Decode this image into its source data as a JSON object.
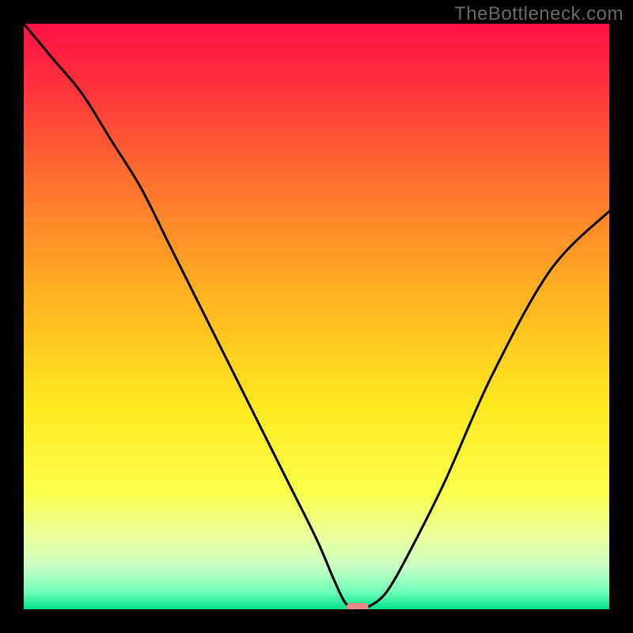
{
  "watermark": "TheBottleneck.com",
  "chart_data": {
    "type": "line",
    "title": "",
    "xlabel": "",
    "ylabel": "",
    "xlim": [
      0,
      100
    ],
    "ylim": [
      0,
      100
    ],
    "legend": false,
    "grid": false,
    "axes_visible": false,
    "background_gradient": {
      "stops": [
        {
          "pos": 0.0,
          "color": "#ff1245"
        },
        {
          "pos": 0.1,
          "color": "#ff2f3d"
        },
        {
          "pos": 0.25,
          "color": "#ff6a2f"
        },
        {
          "pos": 0.45,
          "color": "#ffae22"
        },
        {
          "pos": 0.65,
          "color": "#ffe81e"
        },
        {
          "pos": 0.8,
          "color": "#faff4a"
        },
        {
          "pos": 0.88,
          "color": "#eaffa0"
        },
        {
          "pos": 0.93,
          "color": "#c4ffc4"
        },
        {
          "pos": 0.97,
          "color": "#6fffb8"
        },
        {
          "pos": 1.0,
          "color": "#00e28a"
        }
      ]
    },
    "marker": {
      "x": 57,
      "y": 0,
      "color": "#e98a86",
      "shape": "pill"
    },
    "series": [
      {
        "name": "bottleneck-curve",
        "color": "#000000",
        "x": [
          0,
          5,
          10,
          15,
          20,
          25,
          30,
          35,
          40,
          45,
          50,
          53,
          55,
          57,
          59,
          62,
          66,
          72,
          80,
          90,
          100
        ],
        "y": [
          100,
          94,
          88,
          80,
          72,
          62,
          52,
          42,
          32,
          22,
          12,
          5,
          1,
          0,
          0.5,
          3,
          10,
          22,
          40,
          58,
          68
        ]
      }
    ]
  }
}
